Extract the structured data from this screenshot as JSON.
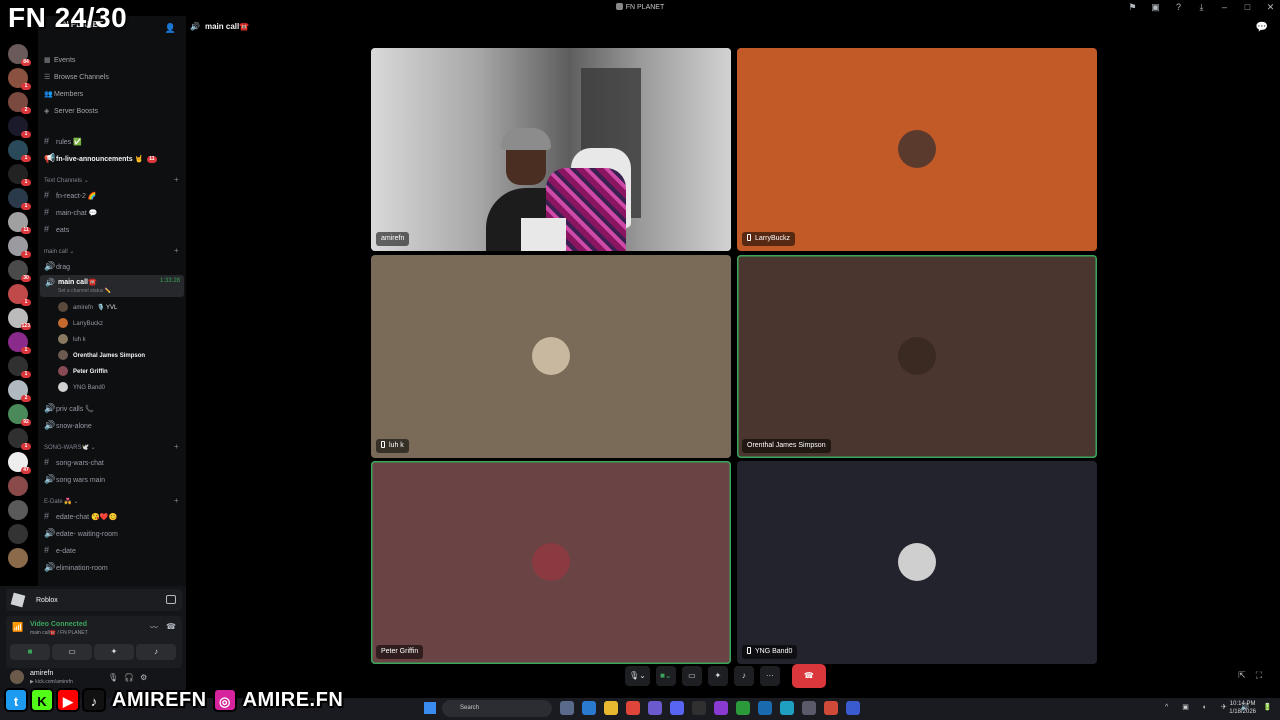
{
  "overlay": {
    "title": "FN 24/30",
    "handle1": "AMIREFN",
    "handle2": "AMIRE.FN"
  },
  "window": {
    "title": "FN PLANET"
  },
  "server": {
    "name": "FN PLANET",
    "nav": [
      "Events",
      "Browse Channels",
      "Members",
      "Server Boosts"
    ],
    "channels_top": [
      {
        "name": "rules ✅"
      },
      {
        "name": "fn-live-announcements 🤘",
        "count": "11"
      }
    ],
    "categories": {
      "text": "Text Channels",
      "main_call": "main call",
      "song_wars": "SONG-WARS🕊️",
      "edate": "E-Date 💑"
    },
    "text_channels": [
      "fn-react-2 🌈",
      "main-chat 💬",
      "eats"
    ],
    "voice_channels_a": [
      "drag"
    ],
    "active_voice": {
      "name": "main call☎️",
      "status": "Set a channel status ✏️",
      "time": "1:33:28"
    },
    "voice_users": [
      {
        "name": "amirefn",
        "extra": "🎙️ YVL",
        "color": "#5a4a3d",
        "bold": false
      },
      {
        "name": "LarryBuckz",
        "color": "#c46a2e",
        "bold": false
      },
      {
        "name": "luh k",
        "color": "#8a7a62",
        "bold": false
      },
      {
        "name": "Orenthal James Simpson",
        "color": "#6b5a50",
        "bold": true
      },
      {
        "name": "Peter Griffin",
        "color": "#8a4a55",
        "bold": true
      },
      {
        "name": "YNG Band0",
        "color": "#d0d0d0",
        "bold": false
      }
    ],
    "voice_channels_b": [
      "priv calls 📞",
      "snow-alone"
    ],
    "song_wars_channels": [
      {
        "name": "song-wars-chat",
        "type": "text"
      },
      {
        "name": "song wars main",
        "type": "voice"
      }
    ],
    "edate_channels": [
      {
        "name": "edate-chat 😘❤️😊",
        "type": "text"
      },
      {
        "name": "edate- waiting-room",
        "type": "voice"
      },
      {
        "name": "e-date",
        "type": "text"
      },
      {
        "name": "elimination-room",
        "type": "voice"
      }
    ]
  },
  "rail_badges": [
    "84",
    "1",
    "2",
    "1",
    "1",
    "1",
    "1",
    "11",
    "1",
    "30",
    "1",
    "123",
    "1",
    "1",
    "2",
    "92",
    "1",
    "47"
  ],
  "rail_new": "NEW",
  "activity": {
    "name": "Roblox"
  },
  "voice_status": {
    "title": "Video Connected",
    "subtitle": "main call☎️ / FN PLANET"
  },
  "me": {
    "name": "amirefn",
    "status": "▶ kick.com/amirefn"
  },
  "call": {
    "header": "main call☎️",
    "tiles": [
      {
        "name": "amirefn",
        "bg": "#888888",
        "video": true,
        "mobile": false,
        "speaking": false
      },
      {
        "name": "LarryBuckz",
        "bg": "#c25a28",
        "mobile": true,
        "speaking": false,
        "pfp": "#5b3a2e"
      },
      {
        "name": "luh k",
        "bg": "#7a6a58",
        "mobile": true,
        "speaking": false,
        "pfp": "#c8b8a0"
      },
      {
        "name": "Orenthal James Simpson",
        "bg": "#4a362e",
        "mobile": false,
        "speaking": true,
        "pfp": "#3a2a22"
      },
      {
        "name": "Peter Griffin",
        "bg": "#6a4444",
        "mobile": false,
        "speaking": true,
        "pfp": "#8a3a40"
      },
      {
        "name": "YNG Band0",
        "bg": "#22232c",
        "mobile": true,
        "speaking": false,
        "pfp": "#cfcfcf"
      }
    ]
  },
  "taskbar": {
    "search": "Search",
    "time": "10:14 PM",
    "date": "1/18/2026"
  }
}
